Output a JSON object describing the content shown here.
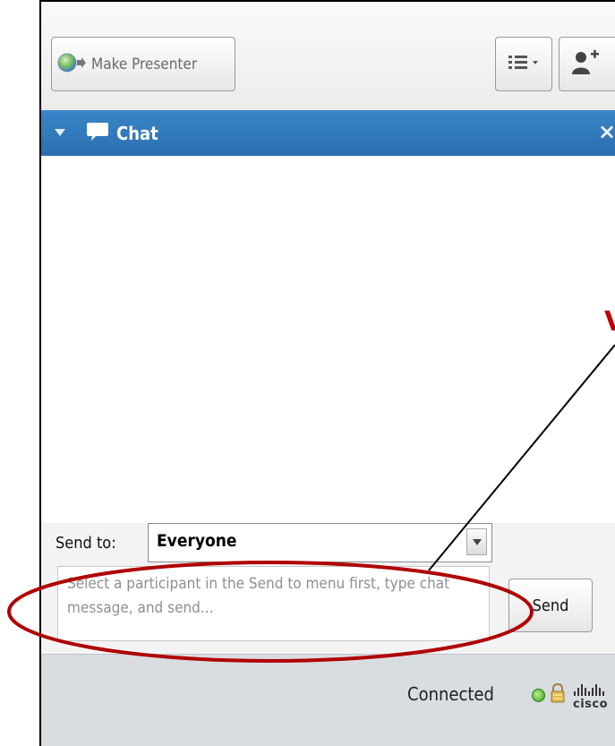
{
  "toolbar": {
    "make_presenter_label": "Make Presenter"
  },
  "chat": {
    "title": "Chat",
    "close_glyph": "×"
  },
  "send": {
    "send_to_label": "Send to:",
    "recipient": "Everyone",
    "message_placeholder": "Select a participant in the Send to menu first, type chat message, and send...",
    "send_button_label": "Send"
  },
  "status": {
    "connection_text": "Connected",
    "brand_text": "cisco"
  },
  "annotation": {
    "partial_red_text": "V",
    "highlight_color": "#b00000",
    "arrow_color": "#000000"
  },
  "colors": {
    "header_blue": "#2f78bb",
    "status_green": "#3c9a1e"
  },
  "icons": [
    "presenter-globe-icon",
    "list-menu-icon",
    "add-participant-icon",
    "chevron-down-icon",
    "chat-bubble-icon",
    "close-icon",
    "dropdown-arrow-icon",
    "status-dot-icon",
    "lock-icon",
    "cisco-logo"
  ]
}
